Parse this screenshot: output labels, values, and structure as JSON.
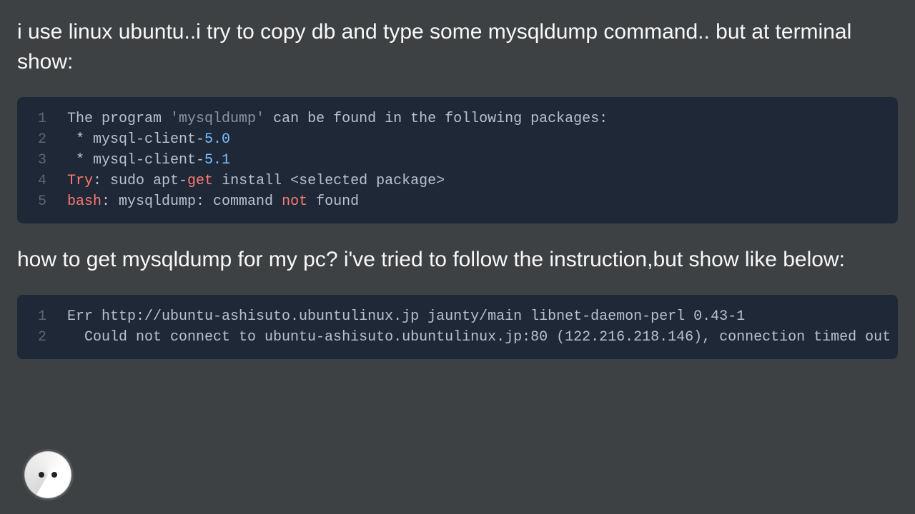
{
  "paragraphs": {
    "p1": "i use linux ubuntu..i try to copy db and type some mysqldump command.. but at terminal show:",
    "p2": "how to get mysqldump for my pc? i've tried to follow the instruction,but show like below:"
  },
  "code1": {
    "gutters": [
      "1",
      "2",
      "3",
      "4",
      "5"
    ],
    "l1a": "The program ",
    "l1b": "'mysqldump'",
    "l1c": " can be found in the following packages:",
    "l2a": " * mysql-client-",
    "l2b": "5.0",
    "l3a": " * mysql-client-",
    "l3b": "5.1",
    "l4a": "Try",
    "l4b": ": sudo apt-",
    "l4c": "get",
    "l4d": " install <selected package>",
    "l5a": "bash",
    "l5b": ": mysqldump: command ",
    "l5c": "not",
    "l5d": " found"
  },
  "code2": {
    "gutters": [
      "1",
      "2"
    ],
    "l1": "Err http://ubuntu-ashisuto.ubuntulinux.jp jaunty/main libnet-daemon-perl 0.43-1",
    "l2": "  Could not connect to ubuntu-ashisuto.ubuntulinux.jp:80 (122.216.218.146), connection timed out"
  }
}
